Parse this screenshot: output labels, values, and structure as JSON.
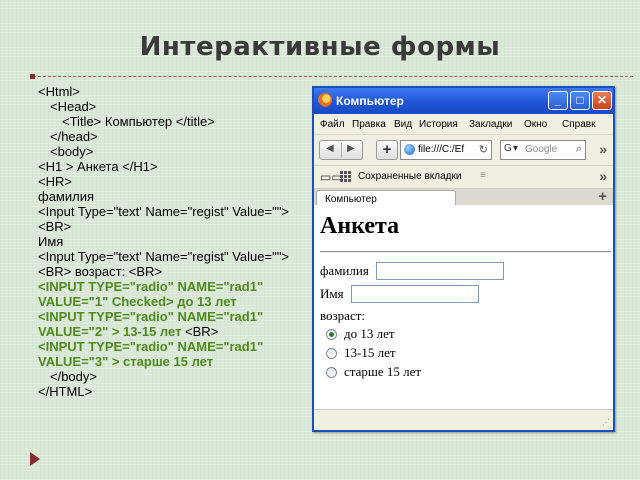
{
  "slide": {
    "title": "Интерактивные формы"
  },
  "code_lines": [
    {
      "text": "<Html>",
      "indent": 0,
      "green": false
    },
    {
      "text": "<Head>",
      "indent": 1,
      "green": false
    },
    {
      "text": "<Title> Компьютер </title>",
      "indent": 2,
      "green": false
    },
    {
      "text": "</head>",
      "indent": 1,
      "green": false
    },
    {
      "text": "<body>",
      "indent": 1,
      "green": false
    },
    {
      "text": "<H1 > Анкета </H1>",
      "indent": 0,
      "green": false
    },
    {
      "text": "<HR>",
      "indent": 0,
      "green": false
    },
    {
      "text": "фамилия",
      "indent": 0,
      "green": false
    },
    {
      "text": "<Input Type=\"text' Name=\"regist\" Value=\"\">",
      "indent": 0,
      "green": false,
      "wrap": true
    },
    {
      "text": "<BR>",
      "indent": 0,
      "green": false
    },
    {
      "text": "Имя",
      "indent": 0,
      "green": false
    },
    {
      "text": "<Input Type=\"text' Name=\"regist\" Value=\"\">",
      "indent": 0,
      "green": false,
      "wrap": true
    },
    {
      "text": "<BR> возраст: <BR>",
      "indent": 0,
      "green": false
    },
    {
      "text": "<INPUT TYPE=\"radio\" NAME=\"rad1\"",
      "indent": 0,
      "green": true
    },
    {
      "text": "VALUE=\"1\" Checked> до 13 лет",
      "indent": 0,
      "green": true
    },
    {
      "text": "<INPUT TYPE=\"radio\" NAME=\"rad1\"",
      "indent": 0,
      "green": true
    },
    {
      "text": "VALUE=\"2\" > 13-15 лет",
      "indent": 0,
      "green": true,
      "suffix": " <BR>"
    },
    {
      "text": "<INPUT TYPE=\"radio\" NAME=\"rad1\"",
      "indent": 0,
      "green": true
    },
    {
      "text": "VALUE=\"3\" > старше 15 лет",
      "indent": 0,
      "green": true
    },
    {
      "text": "</body>",
      "indent": 1,
      "green": false
    },
    {
      "text": "</HTML>",
      "indent": 0,
      "green": false
    }
  ],
  "browser": {
    "title": "Компьютер",
    "title_icon": "firefox-icon",
    "buttons": {
      "minimize": "_",
      "maximize": "□",
      "close": "✕"
    },
    "menu": [
      "Файл",
      "Правка",
      "Вид",
      "История",
      "Закладки",
      "Окно",
      "Справк"
    ],
    "nav": {
      "back_icon": "◀",
      "forward_icon": "▶",
      "new_tab": "+",
      "url": "file:///C:/Ef",
      "reload_icon": "↻",
      "search_engine": "G",
      "search_placeholder": "Google",
      "search_icon": "🔍",
      "overflow": "»"
    },
    "bookmarks": {
      "book_icon": "📖",
      "label": "Сохраненные вкладки",
      "star": "≡",
      "overflow": "»"
    },
    "tab": {
      "label": "Компьютер",
      "new_tab": "+"
    },
    "page": {
      "heading": "Анкета",
      "surname_label": "фамилия",
      "name_label": "Имя",
      "age_label": "возраст:",
      "radios": [
        {
          "label": "до 13 лет",
          "checked": true
        },
        {
          "label": "13-15 лет",
          "checked": false
        },
        {
          "label": "старше 15 лет",
          "checked": false
        }
      ]
    }
  }
}
